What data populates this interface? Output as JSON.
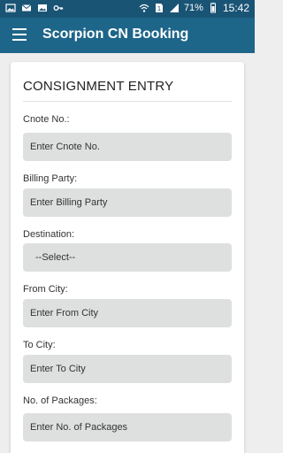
{
  "status_bar": {
    "battery": "71%",
    "time": "15:42"
  },
  "app_bar": {
    "title": "Scorpion CN Booking"
  },
  "form": {
    "title": "CONSIGNMENT ENTRY",
    "cnote": {
      "label": "Cnote No.:",
      "placeholder": "Enter Cnote No."
    },
    "billing_party": {
      "label": "Billing Party:",
      "placeholder": "Enter Billing Party"
    },
    "destination": {
      "label": "Destination:",
      "value": "--Select--"
    },
    "from_city": {
      "label": "From City:",
      "placeholder": "Enter From City"
    },
    "to_city": {
      "label": "To City:",
      "placeholder": "Enter To City"
    },
    "packages": {
      "label": "No. of Packages:",
      "placeholder": "Enter No. of Packages"
    }
  }
}
